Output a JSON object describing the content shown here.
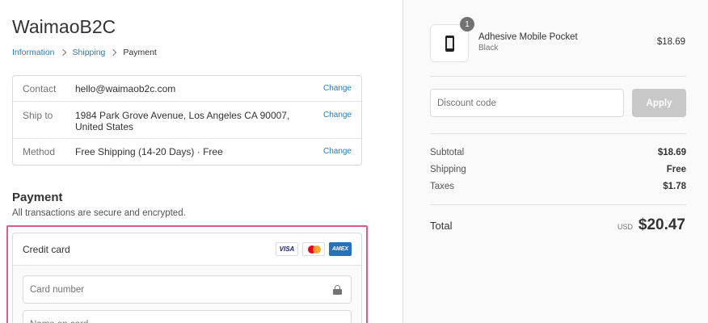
{
  "store": {
    "title": "WaimaoB2C"
  },
  "breadcrumb": [
    {
      "label": "Information"
    },
    {
      "label": "Shipping"
    },
    {
      "label": "Payment"
    }
  ],
  "review": {
    "contact": {
      "label": "Contact",
      "value": "hello@waimaob2c.com",
      "action": "Change"
    },
    "ship_to": {
      "label": "Ship to",
      "value": "1984 Park Grove Avenue, Los Angeles CA 90007, United States",
      "action": "Change"
    },
    "method": {
      "label": "Method",
      "value": "Free Shipping (14-20 Days) · Free",
      "action": "Change"
    }
  },
  "payment": {
    "title": "Payment",
    "subtitle": "All transactions are secure and encrypted.",
    "method_label": "Credit card",
    "card_brands": [
      "VISA",
      "mastercard",
      "AMEX"
    ],
    "card_number_placeholder": "Card number",
    "name_on_card_placeholder": "Name on card"
  },
  "order": {
    "product": {
      "name": "Adhesive Mobile Pocket",
      "variant": "Black",
      "price": "$18.69",
      "quantity": "1"
    },
    "discount_placeholder": "Discount code",
    "apply_label": "Apply",
    "subtotal_label": "Subtotal",
    "subtotal_value": "$18.69",
    "shipping_label": "Shipping",
    "shipping_value": "Free",
    "taxes_label": "Taxes",
    "taxes_value": "$1.78",
    "total_label": "Total",
    "total_currency": "USD",
    "total_value": "$20.47"
  },
  "colors": {
    "accent": "#2a7ab5",
    "highlight": "#e2588f",
    "apply_disabled": "#c8c8c8"
  }
}
